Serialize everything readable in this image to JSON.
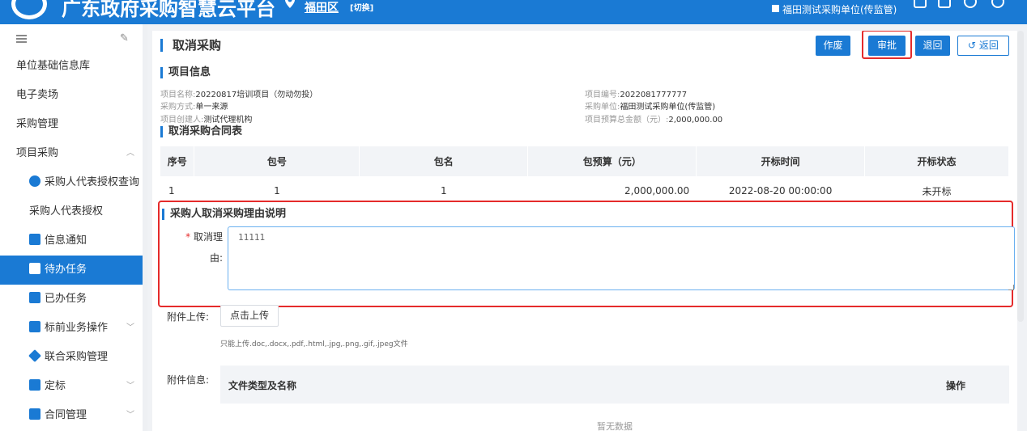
{
  "header": {
    "site_title": "广东政府采购智慧云平台",
    "region": "福田区",
    "switch_label": "[切换]",
    "unit": "福田测试采购单位(传监管)"
  },
  "sidebar": {
    "items": [
      {
        "label": "单位基础信息库",
        "icon": "",
        "level": 1
      },
      {
        "label": "电子卖场",
        "icon": "",
        "level": 1
      },
      {
        "label": "采购管理",
        "icon": "",
        "level": 1
      },
      {
        "label": "项目采购",
        "icon": "chevron-up",
        "level": 1
      },
      {
        "label": "采购人代表授权查询",
        "icon": "gear-icon",
        "level": 2
      },
      {
        "label": "采购人代表授权",
        "icon": "",
        "level": 2
      },
      {
        "label": "信息通知",
        "icon": "notice-icon",
        "level": 2
      },
      {
        "label": "待办任务",
        "icon": "todo-icon",
        "level": 2,
        "active": true
      },
      {
        "label": "已办任务",
        "icon": "done-icon",
        "level": 2
      },
      {
        "label": "标前业务操作",
        "icon": "cart-icon",
        "level": 2
      },
      {
        "label": "联合采购管理",
        "icon": "layers-icon",
        "level": 2
      },
      {
        "label": "定标",
        "icon": "gavel-icon",
        "level": 2
      },
      {
        "label": "合同管理",
        "icon": "lock-icon",
        "level": 2
      }
    ]
  },
  "page": {
    "title": "取消采购",
    "buttons": {
      "void": "作废",
      "approve": "审批",
      "return": "退回",
      "back": "返回"
    }
  },
  "project_info": {
    "section_title": "项目信息",
    "name_label": "项目名称:",
    "name_value": "20220817培训项目（勿动勿投）",
    "method_label": "采购方式:",
    "method_value": "单一来源",
    "creator_label": "项目创建人:",
    "creator_value": "测试代理机构",
    "code_label": "项目编号:",
    "code_value": "2022081777777",
    "unit_label": "采购单位:",
    "unit_value": "福田测试采购单位(传监管)",
    "budget_label": "项目预算总金额（元）:",
    "budget_value": "2,000,000.00"
  },
  "contract_table": {
    "section_title": "取消采购合同表",
    "columns": [
      "序号",
      "包号",
      "包名",
      "包预算（元）",
      "开标时间",
      "开标状态"
    ],
    "rows": [
      [
        "1",
        "1",
        "1",
        "2,000,000.00",
        "2022-08-20 00:00:00",
        "未开标"
      ]
    ]
  },
  "reason": {
    "section_title": "采购人取消采购理由说明",
    "required_mark": "*",
    "label_line1": "取消理",
    "label_line2": "由:",
    "value": "11111"
  },
  "upload": {
    "label": "附件上传:",
    "button": "点击上传",
    "hint": "只能上传.doc,.docx,.pdf,.html,.jpg,.png,.gif,.jpeg文件"
  },
  "attachments": {
    "label": "附件信息:",
    "columns": [
      "文件类型及名称",
      "操作"
    ],
    "empty_text": "暂无数据"
  }
}
